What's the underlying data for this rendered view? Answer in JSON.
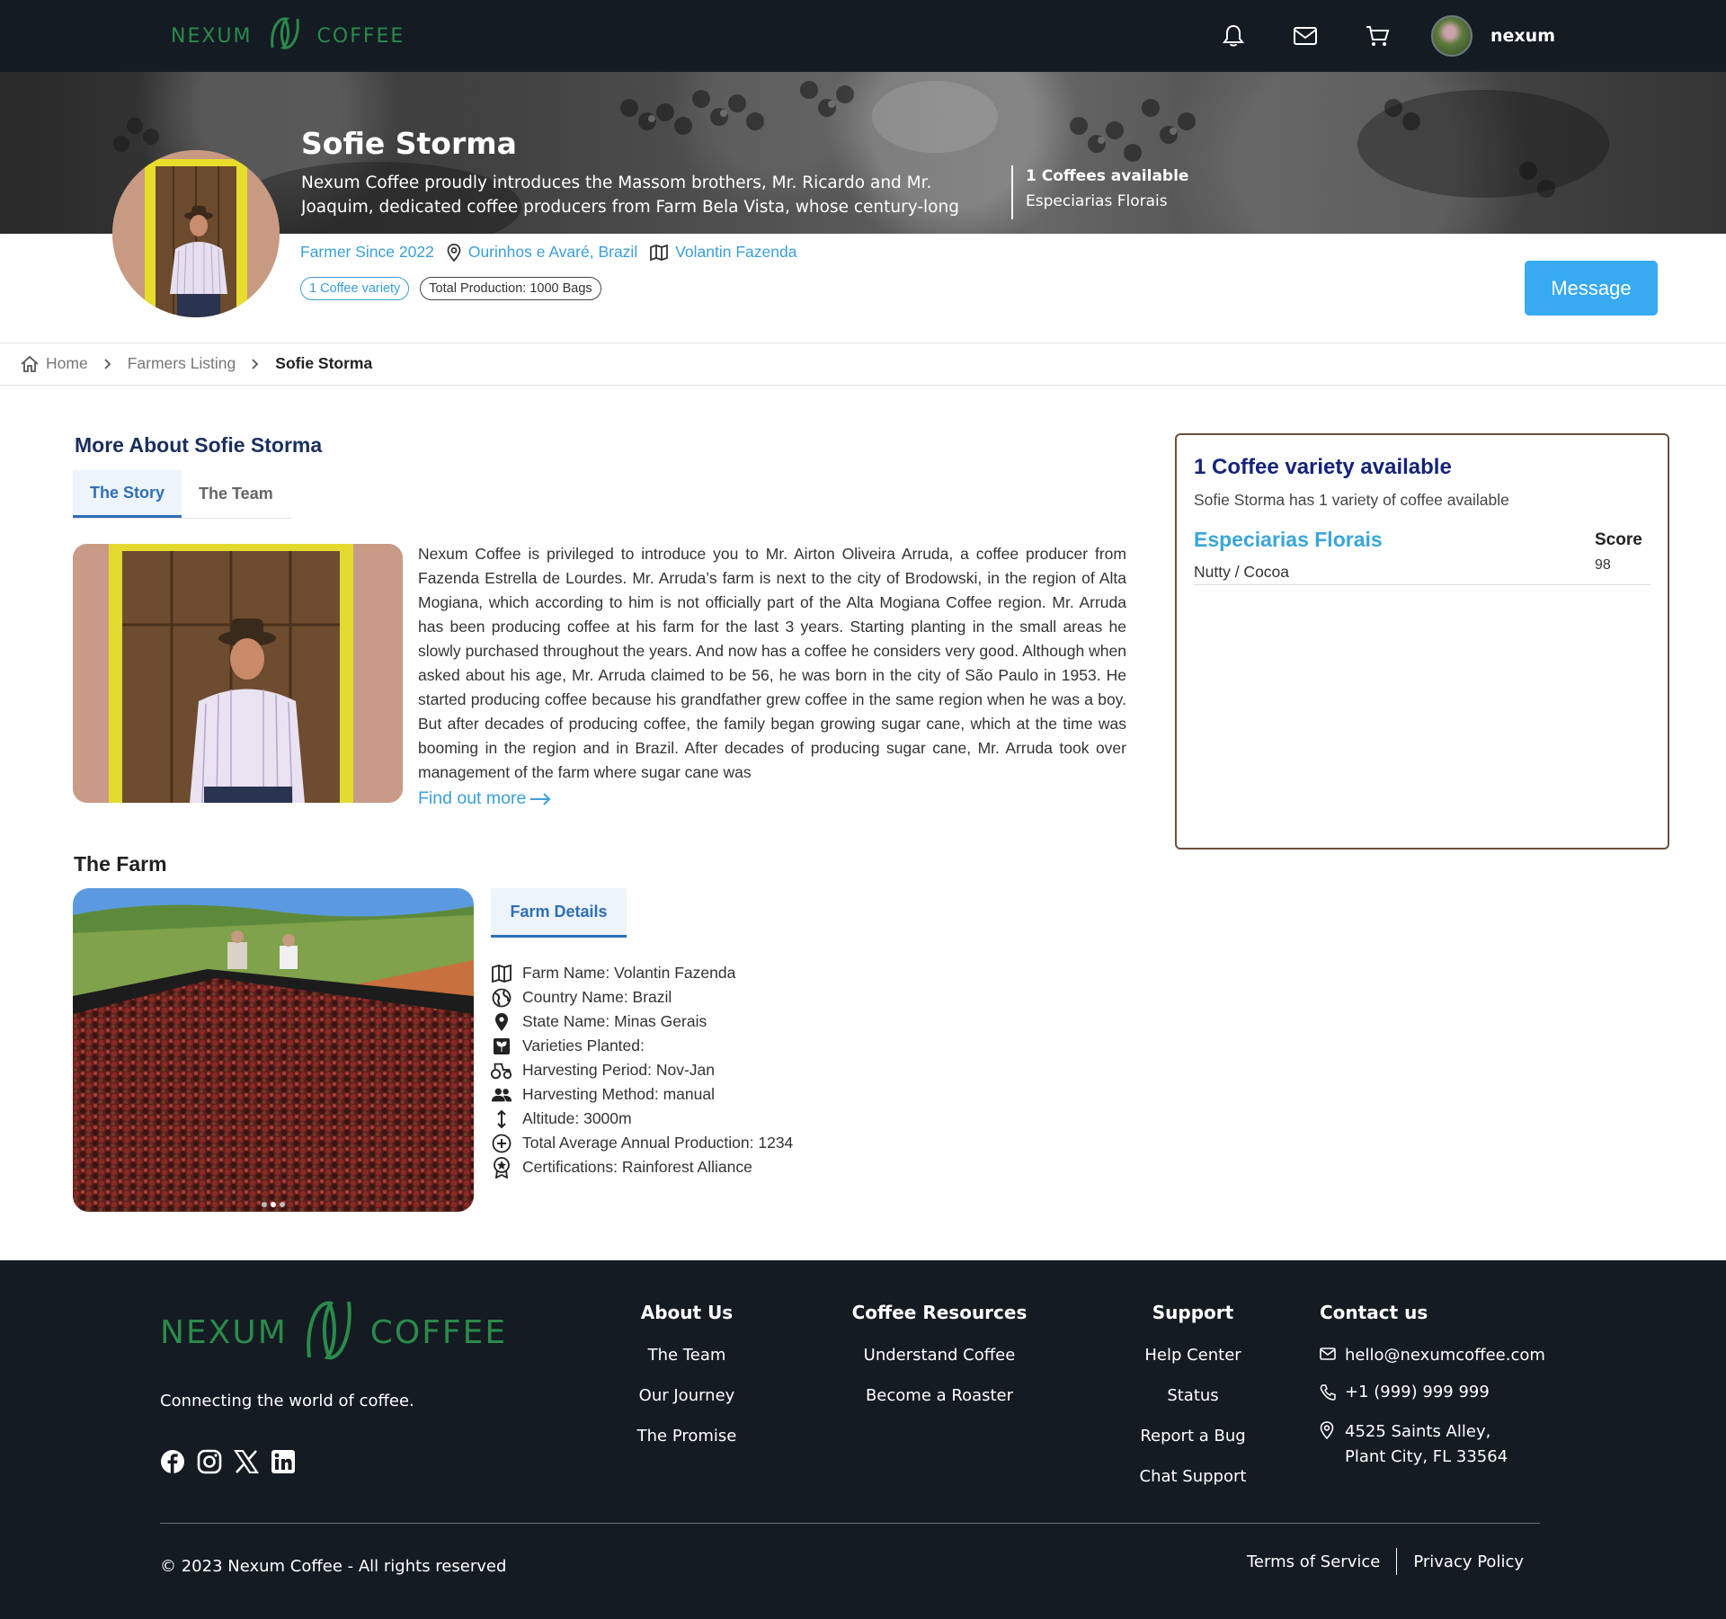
{
  "brand": {
    "left": "NEXUM",
    "right": "COFFEE"
  },
  "nav": {
    "username": "nexum",
    "icons": [
      "bell-icon",
      "mail-icon",
      "cart-icon"
    ]
  },
  "hero": {
    "name": "Sofie Storma",
    "description": "Nexum Coffee proudly introduces the Massom brothers, Mr. Ricardo and Mr. Joaquim, dedicated coffee producers from Farm Bela Vista, whose century-long",
    "available": "1 Coffees available",
    "available_coffee": "Especiarias Florais"
  },
  "profile": {
    "farmer_since": "Farmer Since 2022",
    "location": "Ourinhos e Avaré, Brazil",
    "farm": "Volantin Fazenda",
    "badge_variety": "1 Coffee variety",
    "badge_production": "Total Production: 1000 Bags",
    "message_button": "Message"
  },
  "breadcrumb": {
    "home": "Home",
    "listing": "Farmers Listing",
    "current": "Sofie Storma"
  },
  "about": {
    "title": "More About Sofie Storma",
    "tabs": [
      "The Story",
      "The Team"
    ],
    "story": "Nexum Coffee is privileged to introduce you to Mr. Airton Oliveira Arruda, a coffee producer from Fazenda Estrella de Lourdes. Mr. Arruda’s farm is next to the city of Brodowski, in the region of Alta Mogiana, which according to him is not officially part of the Alta Mogiana Coffee region. Mr. Arruda has been producing coffee at his farm for the last 3 years. Starting planting in the small areas he slowly purchased throughout the years. And now has a coffee he considers very good. Although when asked about his age, Mr. Arruda claimed to be 56, he was born in the city of São Paulo in 1953. He started producing coffee because his grandfather grew coffee in the same region when he was a boy. But after decades of producing coffee, the family began growing sugar cane, which at the time was booming in the region and in Brazil. After decades of producing sugar cane, Mr. Arruda took over management of the farm where sugar cane was",
    "find_more": "Find out more"
  },
  "farm": {
    "title": "The Farm",
    "tab": "Farm Details",
    "details": [
      {
        "icon": "map-icon",
        "text": "Farm Name: Volantin Fazenda"
      },
      {
        "icon": "globe-icon",
        "text": "Country Name: Brazil"
      },
      {
        "icon": "pin-icon",
        "text": "State Name: Minas Gerais"
      },
      {
        "icon": "plant-icon",
        "text": "Varieties Planted:"
      },
      {
        "icon": "tractor-icon",
        "text": "Harvesting Period: Nov-Jan"
      },
      {
        "icon": "people-icon",
        "text": "Harvesting Method: manual"
      },
      {
        "icon": "altitude-icon",
        "text": "Altitude: 3000m"
      },
      {
        "icon": "plus-circle-icon",
        "text": "Total Average Annual Production: 1234"
      },
      {
        "icon": "certificate-icon",
        "text": "Certifications: Rainforest Alliance"
      }
    ]
  },
  "varieties": {
    "title": "1 Coffee variety available",
    "subtitle": "Sofie Storma has 1 variety of coffee available",
    "items": [
      {
        "name": "Especiarias Florais",
        "notes": "Nutty / Cocoa",
        "score_label": "Score",
        "score": "98"
      }
    ]
  },
  "footer": {
    "tagline": "Connecting the world of coffee.",
    "socials": [
      "facebook-icon",
      "instagram-icon",
      "x-icon",
      "linkedin-icon"
    ],
    "columns": [
      {
        "title": "About Us",
        "links": [
          "The Team",
          "Our Journey",
          "The Promise"
        ]
      },
      {
        "title": "Coffee Resources",
        "links": [
          "Understand Coffee",
          "Become a Roaster"
        ]
      },
      {
        "title": "Support",
        "links": [
          "Help Center",
          "Status",
          "Report a Bug",
          "Chat Support"
        ]
      }
    ],
    "contact": {
      "title": "Contact us",
      "email": "hello@nexumcoffee.com",
      "phone": "+1 (999) 999 999",
      "address_line1": "4525 Saints Alley,",
      "address_line2": "Plant City, FL 33564"
    },
    "copyright": "© 2023 Nexum Coffee - All rights reserved",
    "terms": "Terms of Service",
    "privacy": "Privacy Policy"
  },
  "colors": {
    "nav_bg": "#141b23",
    "accent": "#37aaf2",
    "brand_green": "#2b8a4a",
    "link_blue": "#3a9fd8",
    "tab_blue": "#2f6fb8",
    "card_border": "#6b4f3a"
  }
}
